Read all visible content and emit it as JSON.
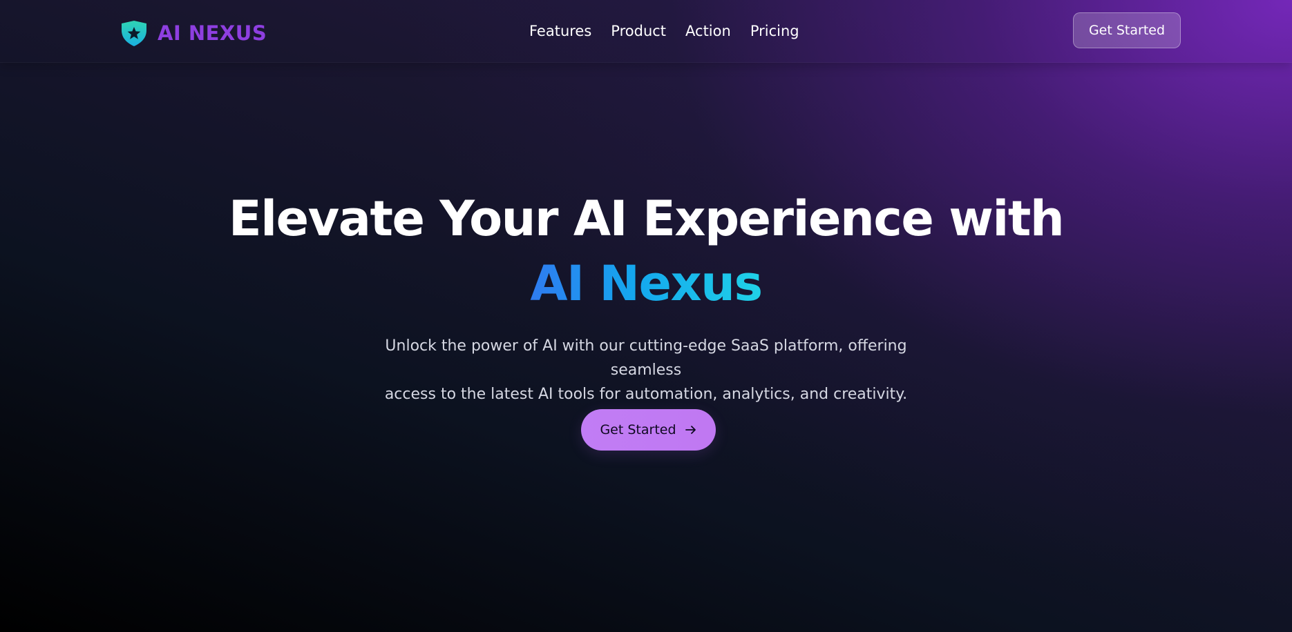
{
  "brand": {
    "name": "AI NEXUS",
    "icon": "shield-star-icon",
    "colors": {
      "wordmark": "#8e3fe0",
      "shield_top": "#2fd3b3",
      "shield_bottom": "#1ab0e0"
    }
  },
  "nav": {
    "links": [
      {
        "label": "Features"
      },
      {
        "label": "Product"
      },
      {
        "label": "Action"
      },
      {
        "label": "Pricing"
      }
    ],
    "cta_label": "Get Started"
  },
  "hero": {
    "title_line1": "Elevate Your AI Experience with",
    "title_line2": "AI Nexus",
    "subtitle_line1": "Unlock the power of AI with our cutting-edge SaaS platform, offering seamless",
    "subtitle_line2": "access to the latest AI tools for automation, analytics, and creativity.",
    "cta_label": "Get Started",
    "cta_icon": "arrow-right-icon"
  },
  "colors": {
    "accent_purple": "#c17df5",
    "gradient_blue_start": "#2f7bf0",
    "gradient_cyan_end": "#20d2e8",
    "background_dark": "#000000",
    "background_purple": "#5a1e96"
  }
}
